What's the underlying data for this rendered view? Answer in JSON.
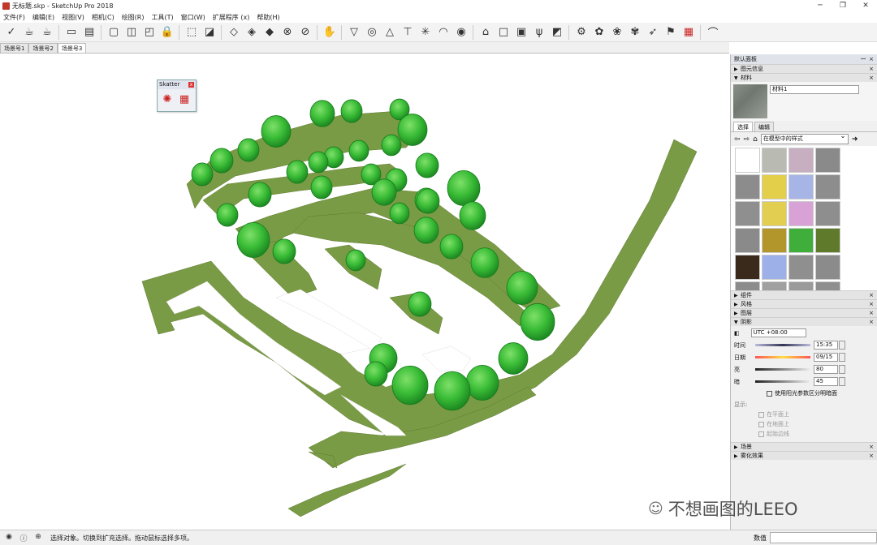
{
  "window": {
    "title": "无标题.skp - SketchUp Pro 2018",
    "controls": [
      "─",
      "❐",
      "✕"
    ]
  },
  "menu": [
    "文件(F)",
    "编辑(E)",
    "视图(V)",
    "相机(C)",
    "绘图(R)",
    "工具(T)",
    "窗口(W)",
    "扩展程序 (x)",
    "帮助(H)"
  ],
  "toolbar_icons": [
    "select-icon",
    "teapot-icon",
    "teapot2-icon",
    "sep",
    "layout-icon",
    "sheet-icon",
    "sep",
    "window-icon",
    "window2-icon",
    "window3-icon",
    "lock-icon",
    "sep",
    "move-icon",
    "copy-icon",
    "sep",
    "box-icon",
    "cube-icon",
    "cube2-icon",
    "circle-icon",
    "circle2-icon",
    "sep",
    "hand-icon",
    "sep",
    "funnel-icon",
    "target-icon",
    "bulb-icon",
    "lamp-icon",
    "sun-icon",
    "arc-icon",
    "ring-icon",
    "sep",
    "cap-icon",
    "box3-icon",
    "cube4-icon",
    "plant-icon",
    "tag-icon",
    "sep",
    "gear-icon",
    "gear2-icon",
    "gear3-icon",
    "gear4-icon",
    "send-icon",
    "flag-icon",
    "grid-red-icon",
    "sep",
    "curve-icon"
  ],
  "scenes": {
    "tabs": [
      "场景号1",
      "场景号2",
      "场景号3"
    ],
    "active": 2
  },
  "scatter": {
    "title": "Skatter",
    "close": "x"
  },
  "panel": {
    "title": "默认面板",
    "entity_info": "图元信息",
    "materials": "材料",
    "material_name": "材料1",
    "tabs": [
      "选择",
      "编辑"
    ],
    "dropdown": "在模型中的样式",
    "swatches": [
      "#ffffff",
      "#b9bbb3",
      "#c7aec1",
      "#8a8a8a",
      "#8c8c8c",
      "#e3cf4a",
      "#a7b5e6",
      "#8d8d8d",
      "#8f8f8f",
      "#e2cf52",
      "#d9a2d6",
      "#8e8e8e",
      "#8a8a8a",
      "#b3962b",
      "#3fae3b",
      "#5e7a2a",
      "#3a2a1c",
      "#9db0e8",
      "#8f8f8f",
      "#8b8b8b",
      "#8c8c8c",
      "#a0a0a0",
      "#9a9a9a",
      "#8e8e8e"
    ],
    "sections_collapsed": [
      "组件",
      "风格",
      "图层"
    ],
    "shadows": {
      "title": "阴影",
      "utc": "UTC +08:00",
      "time_label": "时间",
      "time_value": "15:35",
      "time_ticks": [
        "06:58",
        "中午",
        "19:18"
      ],
      "date_label": "日期",
      "date_value": "09/15",
      "date_ticks": "1 2 3 4 5 6 7 8 9 10 11 12",
      "light_label": "亮",
      "light_value": "80",
      "dark_label": "暗",
      "dark_value": "45",
      "sun_shading": "使用阳光参数区分明暗面",
      "display_label": "显示:",
      "display_options": [
        "在平面上",
        "在地面上",
        "起始边线"
      ]
    },
    "bottom_sections": [
      "场景",
      "雾化效果"
    ]
  },
  "status": {
    "message": "选择对象。切换到扩充选择。拖动鼠标选择多项。",
    "measure_label": "数值",
    "measure_value": ""
  },
  "watermark": "不想画图的LEEO",
  "colors": {
    "tree": "#39c23a",
    "tree_dark": "#1d8a22",
    "ground": "#7a9b45",
    "panel": "#f0f0f0"
  }
}
